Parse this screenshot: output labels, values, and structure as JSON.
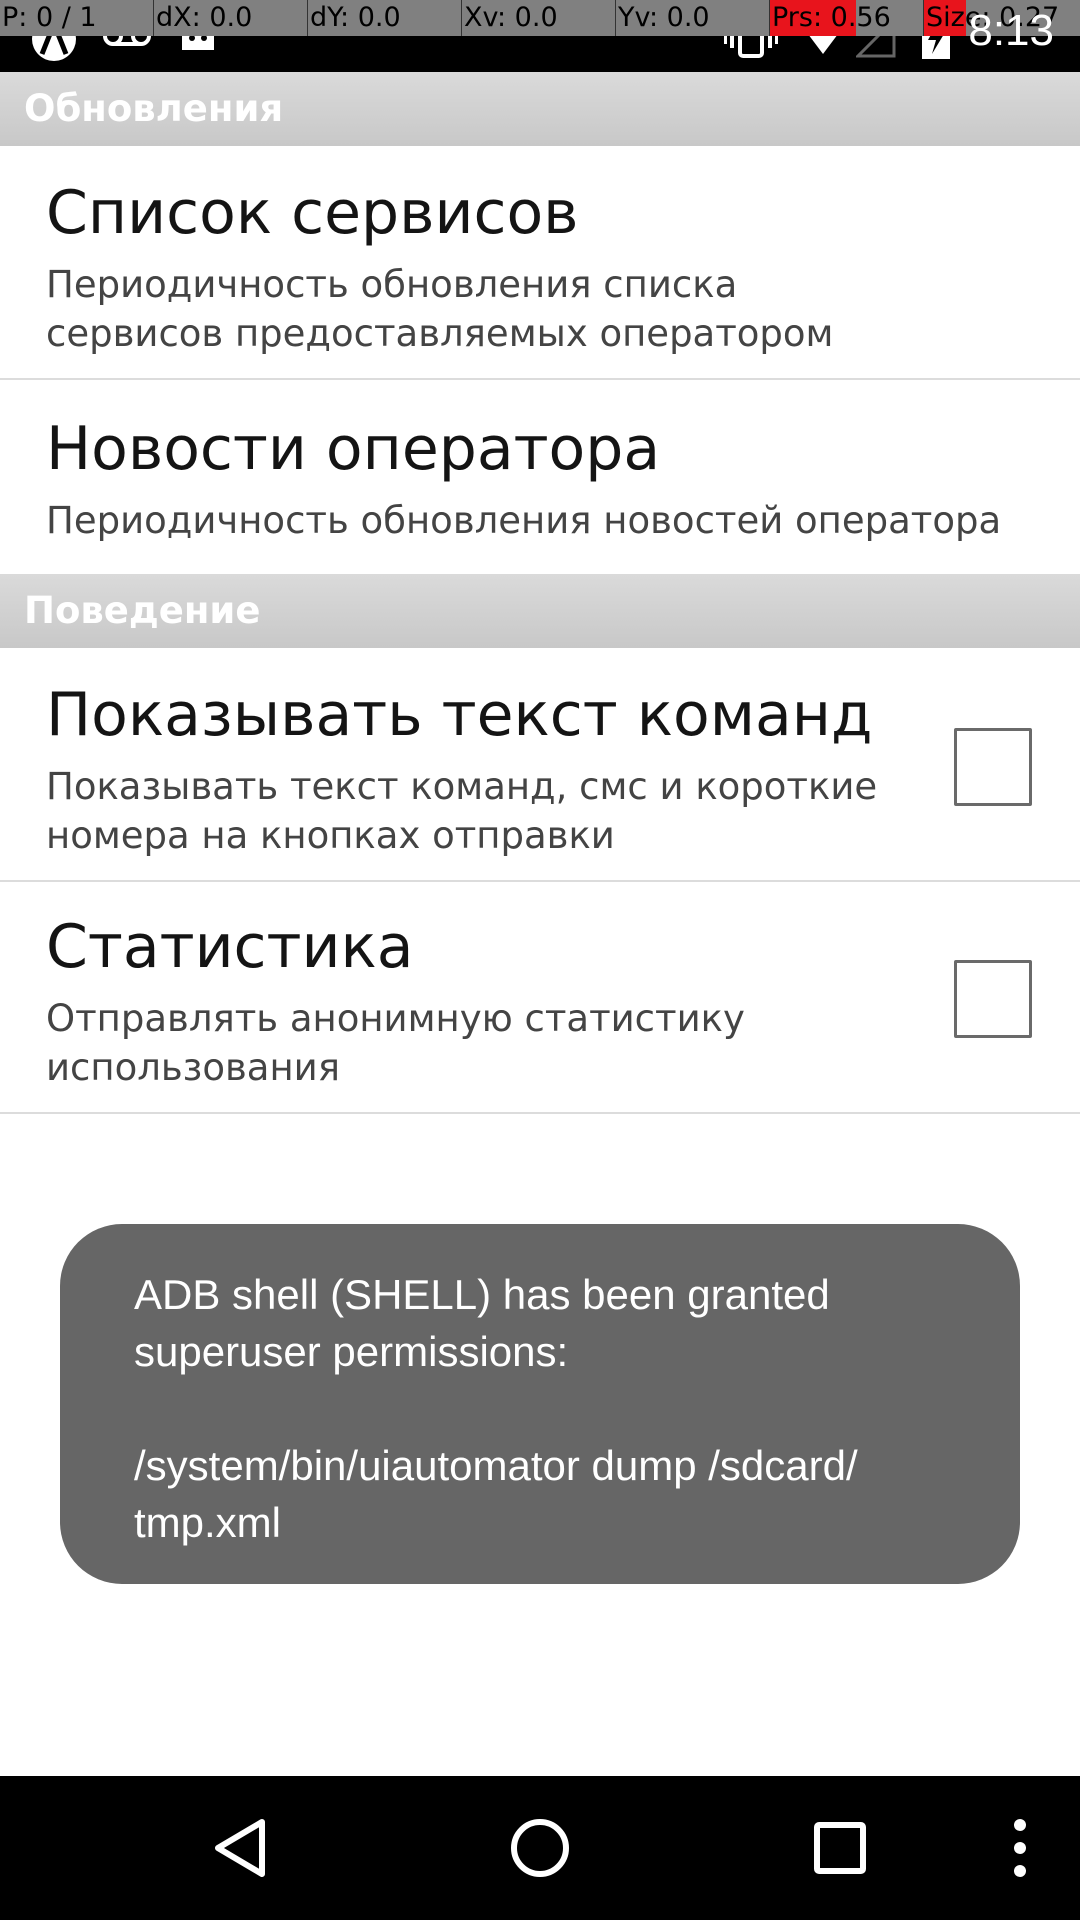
{
  "debug_overlay": {
    "pointer": "P: 0 / 1",
    "dx": "dX: 0.0",
    "dy": "dY: 0.0",
    "xv": "Xv: 0.0",
    "yv": "Yv: 0.0",
    "prs": "Prs: 0.56",
    "size": "Size: 0.27",
    "prs_level": 0.56,
    "size_level": 0.27,
    "accent_color": "#e8141c"
  },
  "status_bar": {
    "time": "8:13",
    "icons": [
      "app-logo-icon",
      "voicemail-icon",
      "android-icon",
      "vibrate-icon",
      "wifi-icon",
      "signal-icon",
      "battery-icon"
    ]
  },
  "sections": [
    {
      "header": "Обновления",
      "items": [
        {
          "title": "Список сервисов",
          "summary": "Периодичность обновления списка сервисов предоставляемых оператором"
        },
        {
          "title": "Новости оператора",
          "summary": "Периодичность обновления новостей оператора"
        }
      ]
    },
    {
      "header": "Поведение",
      "items": [
        {
          "title": "Показывать текст команд",
          "summary": "Показывать текст команд, смс и короткие номера на кнопках отправки",
          "checked": false
        },
        {
          "title": "Статистика",
          "summary": "Отправлять анонимную статистику использования",
          "checked": false
        }
      ]
    }
  ],
  "toast": {
    "message": "ADB shell (SHELL) has been granted\nsuperuser permissions:\n\n/system/bin/uiautomator dump /sdcard/\ntmp.xml"
  },
  "nav_bar": {
    "icons": [
      "back-icon",
      "home-icon",
      "recents-icon",
      "overflow-menu-icon"
    ]
  }
}
